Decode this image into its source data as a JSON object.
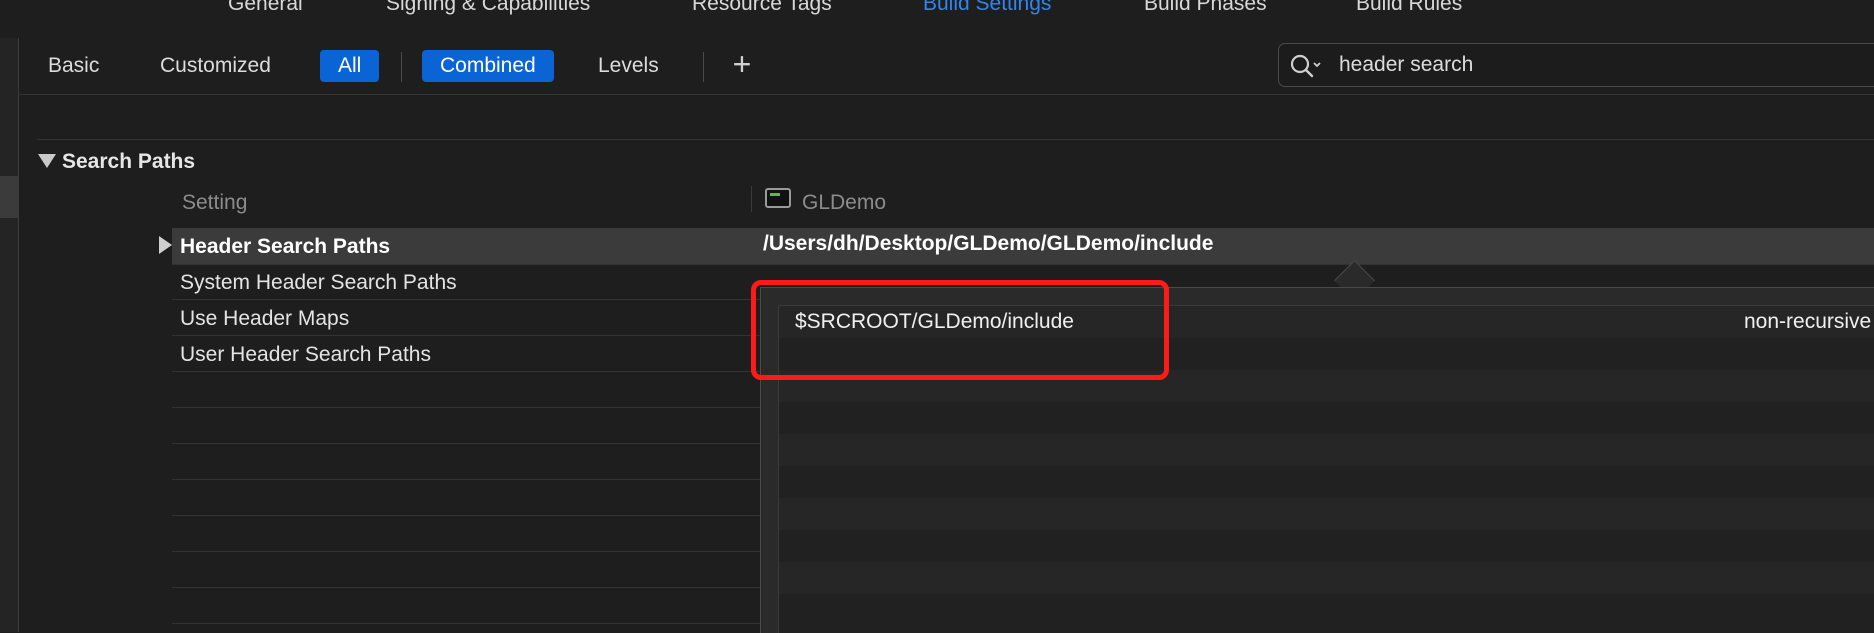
{
  "tabs": [
    {
      "label": "General"
    },
    {
      "label": "Signing & Capabilities"
    },
    {
      "label": "Resource Tags"
    },
    {
      "label": "Build Settings"
    },
    {
      "label": "Build Phases"
    },
    {
      "label": "Build Rules"
    }
  ],
  "active_tab": "Build Settings",
  "filter_bar": {
    "basic": "Basic",
    "customized": "Customized",
    "all": "All",
    "combined": "Combined",
    "levels": "Levels",
    "add": "+"
  },
  "search": {
    "value": "header search",
    "icon": "magnifying-glass-icon"
  },
  "section": {
    "title": "Search Paths",
    "col_setting": "Setting",
    "col_target": "GLDemo",
    "target_icon": "terminal-icon",
    "rows": [
      {
        "label": "Header Search Paths",
        "value": "/Users/dh/Desktop/GLDemo/GLDemo/include"
      },
      {
        "label": "System Header Search Paths"
      },
      {
        "label": "Use Header Maps"
      },
      {
        "label": "User Header Search Paths"
      }
    ]
  },
  "popover": {
    "paths": [
      {
        "path": "$SRCROOT/GLDemo/include",
        "mode": "non-recursive"
      }
    ]
  },
  "colors": {
    "accent": "#0a64d6",
    "active_tab": "#2e86f0",
    "highlight": "#ff1a1a"
  }
}
